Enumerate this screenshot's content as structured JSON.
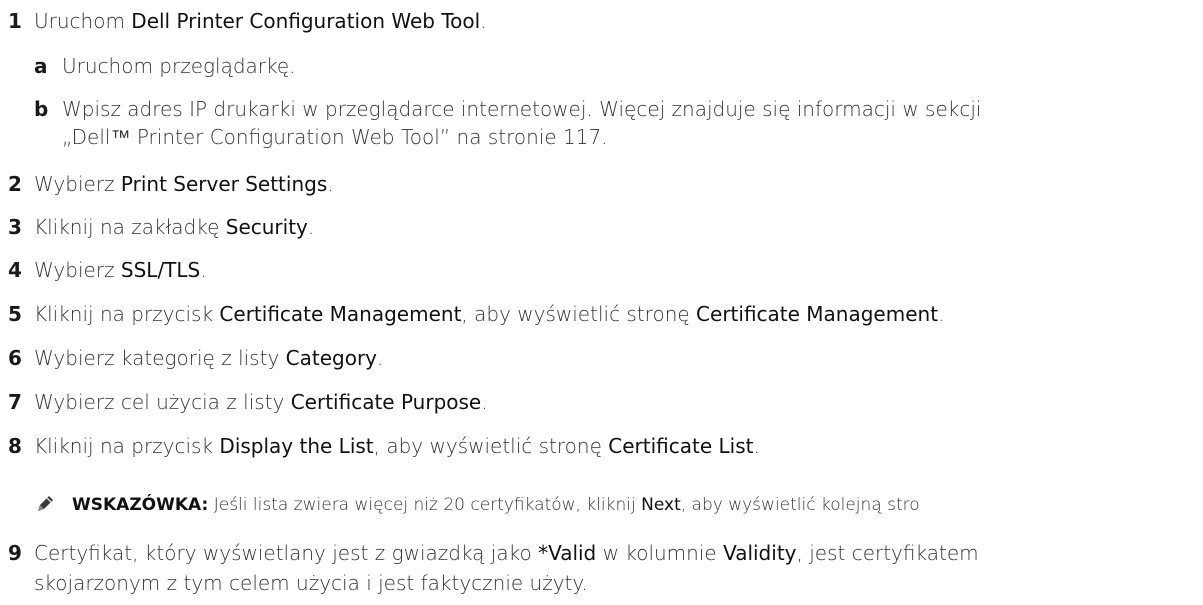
{
  "steps": [
    {
      "num": "1",
      "pre": "Uruchom ",
      "b1": "Dell Printer Configuration Web Tool",
      "post": "."
    },
    {
      "num": "2",
      "pre": "Wybierz ",
      "b1": "Print Server Settings",
      "post": "."
    },
    {
      "num": "3",
      "pre": "Kliknij na zakładkę ",
      "b1": "Security",
      "post": "."
    },
    {
      "num": "4",
      "pre": "Wybierz ",
      "b1": "SSL/TLS",
      "post": "."
    },
    {
      "num": "5",
      "pre": "Kliknij na przycisk ",
      "b1": "Certificate Management",
      "mid": ", aby wyświetlić stronę ",
      "b2": "Certificate Management",
      "post": "."
    },
    {
      "num": "6",
      "pre": "Wybierz kategorię z listy ",
      "b1": "Category",
      "post": "."
    },
    {
      "num": "7",
      "pre": "Wybierz cel użycia z listy ",
      "b1": "Certificate Purpose",
      "post": "."
    },
    {
      "num": "8",
      "pre": "Kliknij na przycisk ",
      "b1": "Display the List",
      "mid": ", aby wyświetlić stronę ",
      "b2": "Certificate List",
      "post": "."
    },
    {
      "num": "9",
      "pre": "Certyfikat, który wyświetlany jest z gwiazdką jako ",
      "b1": "*Valid",
      "mid": " w kolumnie ",
      "b2": "Validity",
      "post": ", jest certyfikatem",
      "line2": "skojarzonym z tym celem użycia i jest faktycznie użyty."
    }
  ],
  "substeps": [
    {
      "letter": "a",
      "text": "Uruchom przeglądarkę."
    },
    {
      "letter": "b",
      "text": "Wpisz adres IP drukarki w przeglądarce internetowej. Więcej znajduje się informacji w sekcji",
      "line2": "„Dell™ Printer Configuration Web Tool” na stronie 117."
    }
  ],
  "note": {
    "icon": "pencil-note-icon",
    "label": "WSKAZÓWKA:",
    "pre": " Jeśli lista zwiera więcej niż 20 certyfikatów, kliknij ",
    "bold": "Next",
    "post": ", aby wyświetlić kolejną stro"
  }
}
